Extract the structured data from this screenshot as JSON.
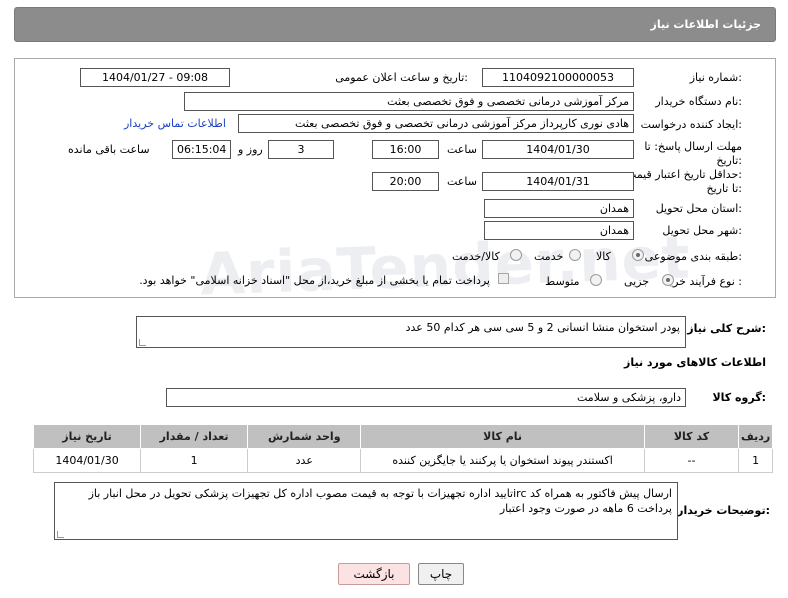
{
  "header": {
    "title": "جزئیات اطلاعات نیاز"
  },
  "form": {
    "need_number_label": "شماره نیاز:",
    "need_number": "1104092100000053",
    "announce_label": "تاریخ و ساعت اعلان عمومی:",
    "announce_value": "1404/01/27 - 09:08",
    "buyer_org_label": "نام دستگاه خریدار:",
    "buyer_org": "مرکز آموزشی درمانی تخصصی و فوق تخصصی بعثت",
    "creator_label": "ایجاد کننده درخواست:",
    "creator": "هادی نوری کارپرداز مرکز آموزشی درمانی تخصصی و فوق تخصصی بعثت",
    "contact_link": "اطلاعات تماس خریدار",
    "deadline_label_1": "مهلت ارسال پاسخ: تا",
    "deadline_label_2": "تاریخ:",
    "deadline_date": "1404/01/30",
    "time_label": "ساعت",
    "deadline_time": "16:00",
    "days_value": "3",
    "days_label": "روز و",
    "remaining_time": "06:15:04",
    "remaining_label": "ساعت باقی مانده",
    "price_validity_label_1": "حداقل تاریخ اعتبار قیمت:",
    "price_validity_label_2": "تا تاریخ:",
    "price_validity_date": "1404/01/31",
    "price_validity_time": "20:00",
    "province_label": "استان محل تحویل:",
    "province": "همدان",
    "city_label": "شهر محل تحویل:",
    "city": "همدان",
    "category_label": "طبقه بندی موضوعی:",
    "category_options": [
      "کالا",
      "خدمت",
      "کالا/خدمت"
    ],
    "process_label": "نوع فرآیند خرید :",
    "process_options": [
      "جزیی",
      "متوسط"
    ],
    "payment_note": "پرداخت تمام یا بخشی از مبلغ خرید،از محل \"اسناد خزانه اسلامی\" خواهد بود."
  },
  "description": {
    "label": "شرح کلی نیاز:",
    "text": "پودر استخوان منشا انسانی 2 و 5 سی سی هر کدام 50 عدد"
  },
  "goods": {
    "section_title": "اطلاعات کالاهای مورد نیاز",
    "group_label": "گروه کالا:",
    "group_value": "دارو، پزشکی و سلامت",
    "columns": [
      "ردیف",
      "کد کالا",
      "نام کالا",
      "واحد شمارش",
      "تعداد / مقدار",
      "تاریخ نیاز"
    ],
    "rows": [
      [
        "1",
        "--",
        "اکستندر پیوند استخوان یا پرکنند یا جایگزین کننده",
        "عدد",
        "1",
        "1404/01/30"
      ]
    ]
  },
  "buyer_notes": {
    "label": "توضیحات خریدار:",
    "text": "ارسال پیش فاکتور به همراه کد ircتایید اداره تجهیزات  با توجه به قیمت مصوب اداره کل تجهیزات پزشکی تحویل در محل انبار باز پرداخت 6 ماهه در صورت وجود اعتبار"
  },
  "buttons": {
    "print": "چاپ",
    "back": "بازگشت"
  },
  "watermark": "AriaTender.net"
}
